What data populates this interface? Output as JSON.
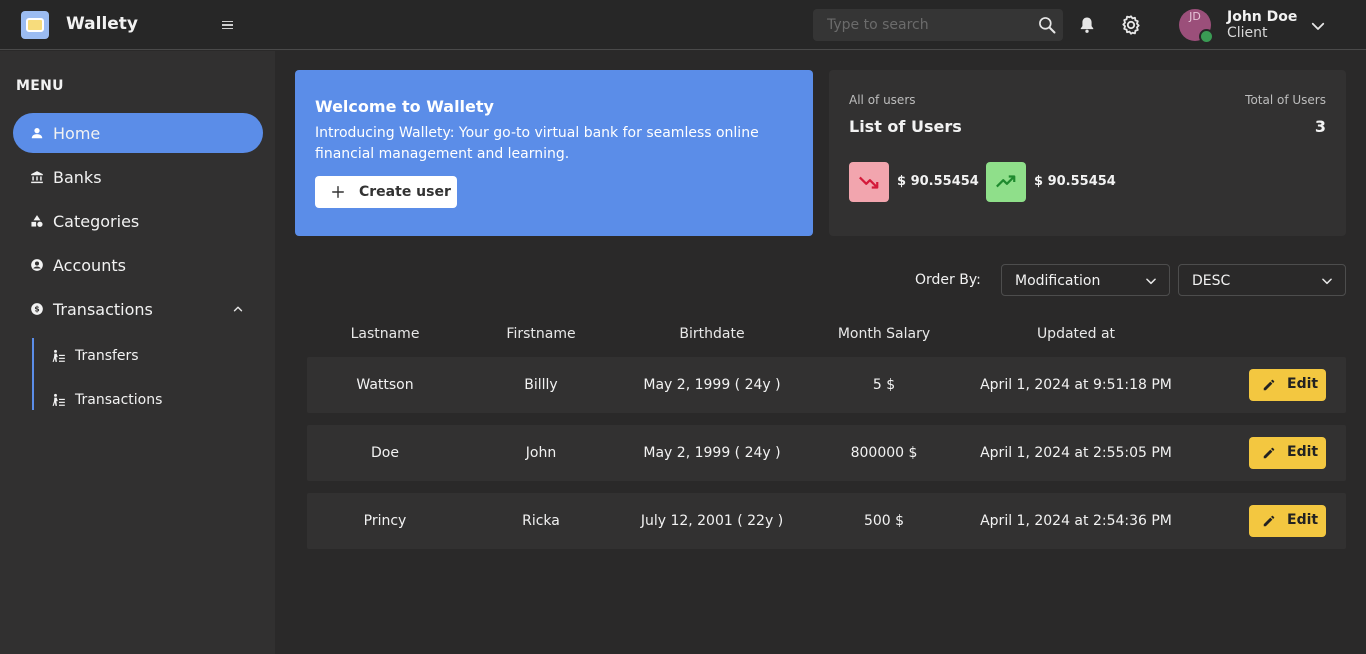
{
  "app": {
    "title": "Wallety"
  },
  "search": {
    "placeholder": "Type to search"
  },
  "user": {
    "initials": "JD",
    "name": "John Doe",
    "role": "Client"
  },
  "sidebar": {
    "heading": "MENU",
    "items": [
      {
        "label": "Home",
        "icon": "person-icon",
        "active": true
      },
      {
        "label": "Banks",
        "icon": "bank-icon"
      },
      {
        "label": "Categories",
        "icon": "shapes-icon"
      },
      {
        "label": "Accounts",
        "icon": "account-circle-icon"
      },
      {
        "label": "Transactions",
        "icon": "dollar-circle-icon",
        "expanded": true
      }
    ],
    "subitems": [
      {
        "label": "Transfers",
        "icon": "transfer-icon"
      },
      {
        "label": "Transactions",
        "icon": "transfer-icon"
      }
    ]
  },
  "welcome": {
    "title": "Welcome to Wallety",
    "text": "Introducing Wallety: Your go-to virtual bank for seamless online financial management and learning.",
    "button": "Create user"
  },
  "users_card": {
    "subtitle": "All of users",
    "title": "List of Users",
    "total_label": "Total of Users",
    "total_value": "3",
    "stats": [
      {
        "trend": "down",
        "value": "$ 90.55454",
        "color": "#f2a5ae"
      },
      {
        "trend": "up",
        "value": "$ 90.55454",
        "color": "#8fdf8a"
      }
    ]
  },
  "order": {
    "label": "Order By:",
    "field": "Modification",
    "direction": "DESC"
  },
  "table": {
    "headers": [
      "Lastname",
      "Firstname",
      "Birthdate",
      "Month Salary",
      "Updated at"
    ],
    "edit_label": "Edit",
    "rows": [
      {
        "lastname": "Wattson",
        "firstname": "Billly",
        "birthdate": "May 2, 1999 ( 24y )",
        "salary": "5 $",
        "updated": "April 1, 2024 at 9:51:18 PM"
      },
      {
        "lastname": "Doe",
        "firstname": "John",
        "birthdate": "May 2, 1999 ( 24y )",
        "salary": "800000 $",
        "updated": "April 1, 2024 at 2:55:05 PM"
      },
      {
        "lastname": "Princy",
        "firstname": "Ricka",
        "birthdate": "July 12, 2001 ( 22y )",
        "salary": "500 $",
        "updated": "April 1, 2024 at 2:54:36 PM"
      }
    ]
  },
  "colors": {
    "accent": "#5b8de8",
    "edit": "#f3c740",
    "background": "#2a2929",
    "sidebar": "#313030"
  }
}
